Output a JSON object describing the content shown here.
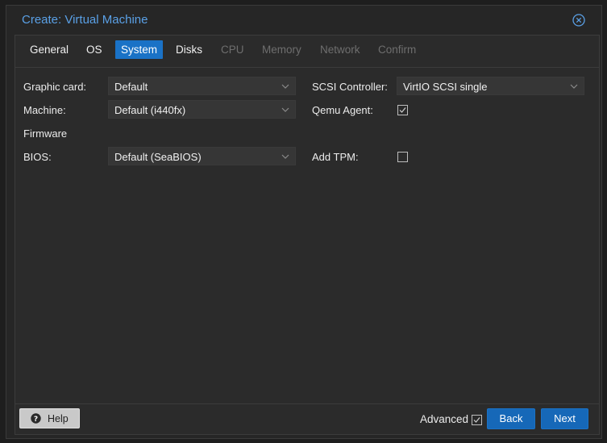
{
  "dialog": {
    "title": "Create: Virtual Machine",
    "close_icon": "close-circle-icon"
  },
  "tabs": [
    {
      "label": "General",
      "state": "enabled"
    },
    {
      "label": "OS",
      "state": "enabled"
    },
    {
      "label": "System",
      "state": "active"
    },
    {
      "label": "Disks",
      "state": "enabled"
    },
    {
      "label": "CPU",
      "state": "disabled"
    },
    {
      "label": "Memory",
      "state": "disabled"
    },
    {
      "label": "Network",
      "state": "disabled"
    },
    {
      "label": "Confirm",
      "state": "disabled"
    }
  ],
  "form": {
    "graphic_card": {
      "label": "Graphic card:",
      "value": "Default"
    },
    "machine": {
      "label": "Machine:",
      "value": "Default (i440fx)"
    },
    "firmware_heading": "Firmware",
    "bios": {
      "label": "BIOS:",
      "value": "Default (SeaBIOS)"
    },
    "scsi_controller": {
      "label": "SCSI Controller:",
      "value": "VirtIO SCSI single"
    },
    "qemu_agent": {
      "label": "Qemu Agent:",
      "checked": true
    },
    "add_tpm": {
      "label": "Add TPM:",
      "checked": false
    }
  },
  "footer": {
    "help_label": "Help",
    "advanced_label": "Advanced",
    "advanced_checked": true,
    "back_label": "Back",
    "next_label": "Next"
  },
  "colors": {
    "accent": "#1a72c6",
    "title": "#5aa0e6",
    "background": "#262626"
  }
}
